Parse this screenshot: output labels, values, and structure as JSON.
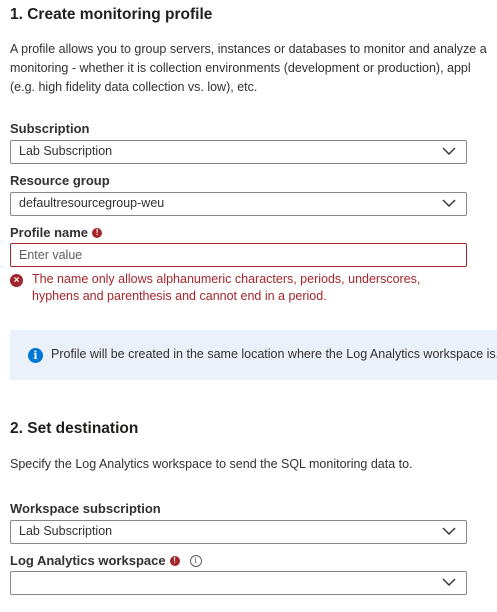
{
  "section1": {
    "title": "1. Create monitoring profile",
    "description_lines": [
      "A profile allows you to group servers, instances or databases to monitor and analyze a",
      "monitoring - whether it is collection environments (development or production), appl",
      "(e.g. high fidelity data collection vs. low), etc."
    ],
    "subscription": {
      "label": "Subscription",
      "value": "Lab Subscription"
    },
    "resource_group": {
      "label": "Resource group",
      "value": "defaultresourcegroup-weu"
    },
    "profile_name": {
      "label": "Profile name",
      "required_marker": "!",
      "placeholder": "Enter value",
      "value": "",
      "error_icon": "error-circle-icon",
      "error_lines": [
        "The name only allows alphanumeric characters, periods, underscores,",
        "hyphens and parenthesis and cannot end in a period."
      ]
    },
    "info_bar": {
      "icon": "info-icon",
      "text": "Profile will be created in the same location where the Log Analytics workspace is."
    }
  },
  "section2": {
    "title": "2. Set destination",
    "description": "Specify the Log Analytics workspace to send the SQL monitoring data to.",
    "workspace_subscription": {
      "label": "Workspace subscription",
      "value": "Lab Subscription"
    },
    "log_analytics_workspace": {
      "label": "Log Analytics workspace",
      "required_marker": "!",
      "info_marker": "i",
      "value": ""
    }
  },
  "colors": {
    "error": "#a4262c",
    "info_icon": "#0078d4",
    "info_bar_bg": "#ebf1fa",
    "border": "#8a8886",
    "text": "#323130"
  }
}
